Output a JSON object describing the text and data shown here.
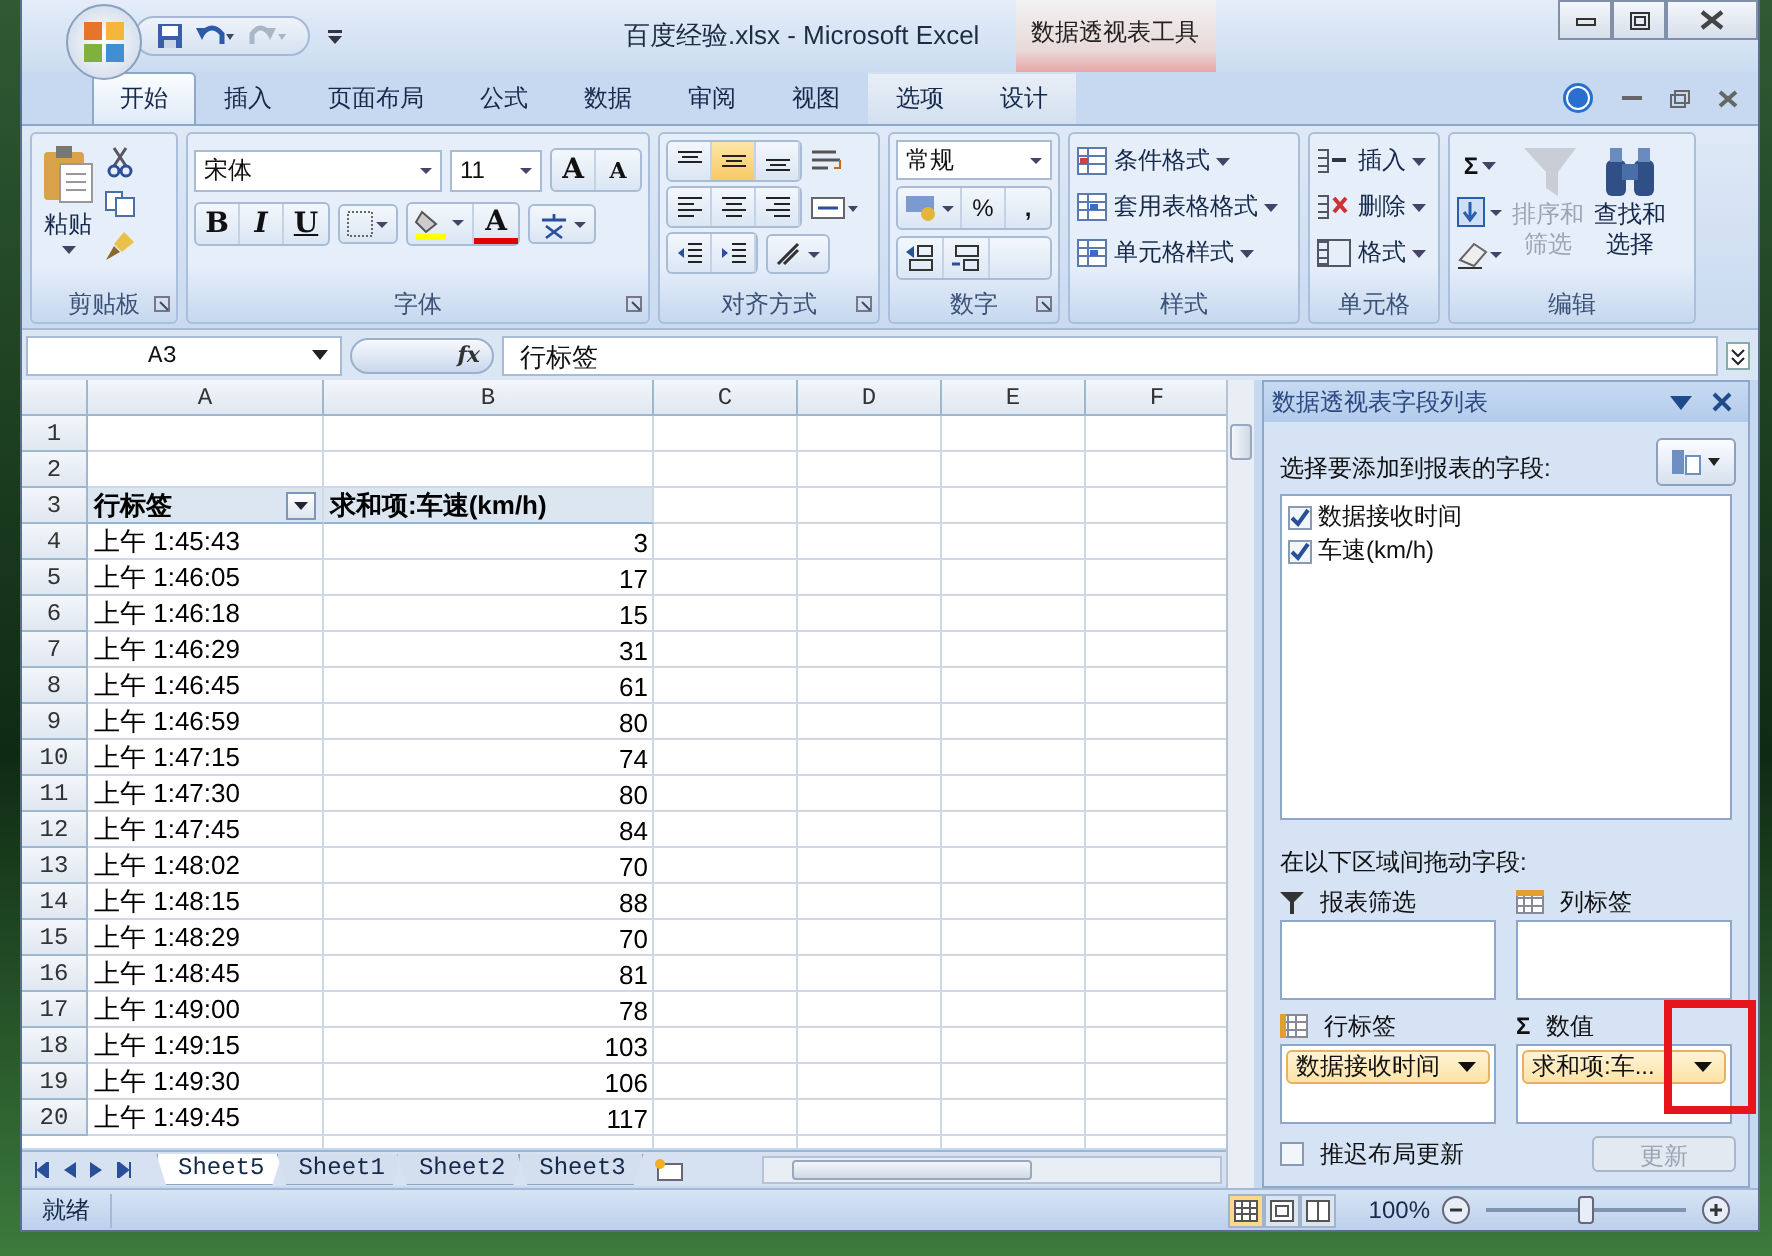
{
  "window": {
    "title": "百度经验.xlsx - Microsoft Excel",
    "context_group": "数据透视表工具"
  },
  "tabs": [
    {
      "label": "开始",
      "selected": true,
      "contextual": false
    },
    {
      "label": "插入",
      "selected": false,
      "contextual": false
    },
    {
      "label": "页面布局",
      "selected": false,
      "contextual": false
    },
    {
      "label": "公式",
      "selected": false,
      "contextual": false
    },
    {
      "label": "数据",
      "selected": false,
      "contextual": false
    },
    {
      "label": "审阅",
      "selected": false,
      "contextual": false
    },
    {
      "label": "视图",
      "selected": false,
      "contextual": false
    },
    {
      "label": "选项",
      "selected": false,
      "contextual": true
    },
    {
      "label": "设计",
      "selected": false,
      "contextual": true
    }
  ],
  "ribbon": [
    {
      "kind": "clipboard",
      "label": "剪贴板",
      "paste": "粘贴"
    },
    {
      "kind": "font",
      "label": "字体",
      "font_name": "宋体",
      "font_size": "11",
      "grow": "A",
      "shrink": "A",
      "bold": "B",
      "italic": "I",
      "underline": "U",
      "font_color": "A"
    },
    {
      "kind": "alignment",
      "label": "对齐方式",
      "valign_buttons": [
        {
          "kind": "top",
          "selected": false
        },
        {
          "kind": "middle",
          "selected": true
        },
        {
          "kind": "bottom",
          "selected": false
        }
      ]
    },
    {
      "kind": "number",
      "label": "数字",
      "format": "常规",
      "percent": "%",
      "comma": ","
    },
    {
      "kind": "styles",
      "label": "样式",
      "items": [
        "条件格式",
        "套用表格格式",
        "单元格样式"
      ]
    },
    {
      "kind": "cells",
      "label": "单元格",
      "items": [
        "插入",
        "删除",
        "格式"
      ]
    },
    {
      "kind": "editing",
      "label": "编辑",
      "sigma": "Σ",
      "sort": {
        "lines": [
          "排序和",
          "筛选"
        ],
        "disabled": true
      },
      "find": {
        "lines": [
          "查找和",
          "选择"
        ],
        "disabled": false
      }
    }
  ],
  "formula_bar": {
    "name_box": "A3",
    "fx": "fx",
    "content": "行标签"
  },
  "sheet": {
    "columns": [
      "A",
      "B",
      "C",
      "D",
      "E",
      "F"
    ],
    "rows": [
      {
        "number": "1",
        "kind": "empty"
      },
      {
        "number": "2",
        "kind": "empty"
      },
      {
        "number": "3",
        "kind": "header",
        "label": "行标签",
        "value": "求和项:车速(km/h)"
      },
      {
        "number": "4",
        "kind": "data",
        "label": "上午 1:45:43",
        "value": "3"
      },
      {
        "number": "5",
        "kind": "data",
        "label": "上午 1:46:05",
        "value": "17"
      },
      {
        "number": "6",
        "kind": "data",
        "label": "上午 1:46:18",
        "value": "15"
      },
      {
        "number": "7",
        "kind": "data",
        "label": "上午 1:46:29",
        "value": "31"
      },
      {
        "number": "8",
        "kind": "data",
        "label": "上午 1:46:45",
        "value": "61"
      },
      {
        "number": "9",
        "kind": "data",
        "label": "上午 1:46:59",
        "value": "80"
      },
      {
        "number": "10",
        "kind": "data",
        "label": "上午 1:47:15",
        "value": "74"
      },
      {
        "number": "11",
        "kind": "data",
        "label": "上午 1:47:30",
        "value": "80"
      },
      {
        "number": "12",
        "kind": "data",
        "label": "上午 1:47:45",
        "value": "84"
      },
      {
        "number": "13",
        "kind": "data",
        "label": "上午 1:48:02",
        "value": "70"
      },
      {
        "number": "14",
        "kind": "data",
        "label": "上午 1:48:15",
        "value": "88"
      },
      {
        "number": "15",
        "kind": "data",
        "label": "上午 1:48:29",
        "value": "70"
      },
      {
        "number": "16",
        "kind": "data",
        "label": "上午 1:48:45",
        "value": "81"
      },
      {
        "number": "17",
        "kind": "data",
        "label": "上午 1:49:00",
        "value": "78"
      },
      {
        "number": "18",
        "kind": "data",
        "label": "上午 1:49:15",
        "value": "103"
      },
      {
        "number": "19",
        "kind": "data",
        "label": "上午 1:49:30",
        "value": "106"
      },
      {
        "number": "20",
        "kind": "data",
        "label": "上午 1:49:45",
        "value": "117"
      }
    ]
  },
  "sheet_tabs": [
    {
      "label": "Sheet5",
      "selected": true
    },
    {
      "label": "Sheet1",
      "selected": false
    },
    {
      "label": "Sheet2",
      "selected": false
    },
    {
      "label": "Sheet3",
      "selected": false
    }
  ],
  "pivot_panel": {
    "title": "数据透视表字段列表",
    "field_prompt": "选择要添加到报表的字段:",
    "fields": [
      {
        "label": "数据接收时间",
        "checked": true
      },
      {
        "label": "车速(km/h)",
        "checked": true
      }
    ],
    "area_prompt": "在以下区域间拖动字段:",
    "areas": [
      {
        "kind": "filter",
        "label": "报表筛选"
      },
      {
        "kind": "columns",
        "label": "列标签"
      },
      {
        "kind": "rows",
        "label": "行标签",
        "items": [
          "数据接收时间"
        ]
      },
      {
        "kind": "values",
        "label": "数值",
        "symbol": "Σ",
        "items": [
          "求和项:车..."
        ]
      }
    ],
    "defer": {
      "label": "推迟布局更新",
      "checked": false
    },
    "update_button": {
      "label": "更新",
      "disabled": true
    }
  },
  "status_bar": {
    "status": "就绪",
    "zoom": "100%",
    "zoom_slider": {
      "level": 0.5
    }
  },
  "annotation": {
    "kind": "highlight"
  }
}
